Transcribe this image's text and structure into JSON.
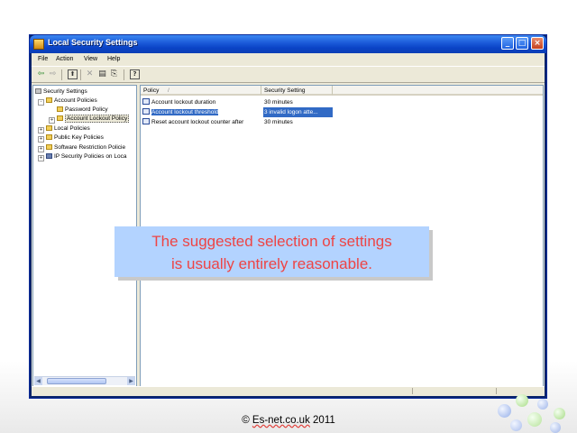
{
  "window": {
    "title": "Local Security Settings",
    "buttons": {
      "minimize": "_",
      "maximize": "□",
      "close": "×"
    }
  },
  "menu": [
    "File",
    "Action",
    "View",
    "Help"
  ],
  "toolbar": {
    "icons": [
      "back-arrow-icon",
      "forward-arrow-icon",
      "up-folder-icon",
      "delete-icon",
      "properties-icon",
      "export-icon",
      "help-icon"
    ],
    "glyphs": {
      "back": "⇦",
      "forward": "⇨",
      "up": "⬆",
      "delete": "✕",
      "properties": "▤",
      "export": "⎘",
      "help": "?"
    }
  },
  "tree": {
    "root": "Security Settings",
    "items": [
      {
        "label": "Account Policies"
      },
      {
        "label": "Password Policy"
      },
      {
        "label": "Account Lockout Policy",
        "selected": true
      },
      {
        "label": "Local Policies"
      },
      {
        "label": "Public Key Policies"
      },
      {
        "label": "Software Restriction Policie"
      },
      {
        "label": "IP Security Policies on Loca"
      }
    ]
  },
  "list": {
    "columns": [
      "Policy",
      "Security Setting"
    ],
    "sort_glyph": "/",
    "rows": [
      {
        "policy": "Account lockout duration",
        "setting": "30 minutes"
      },
      {
        "policy": "Account lockout threshold",
        "setting": "3 invalid logon atte...",
        "selected": true
      },
      {
        "policy": "Reset account lockout counter after",
        "setting": "30 minutes"
      }
    ]
  },
  "callout": {
    "line1": "The suggested selection of settings",
    "line2": "is usually entirely reasonable."
  },
  "footer": {
    "prefix": "© ",
    "site": "Es-net.co.uk",
    "year": " 2011"
  },
  "colors": {
    "selection": "#316ac5",
    "callout_bg": "#b3d3ff",
    "callout_text": "#ee4444",
    "titlebar": "#1d5ddb"
  }
}
